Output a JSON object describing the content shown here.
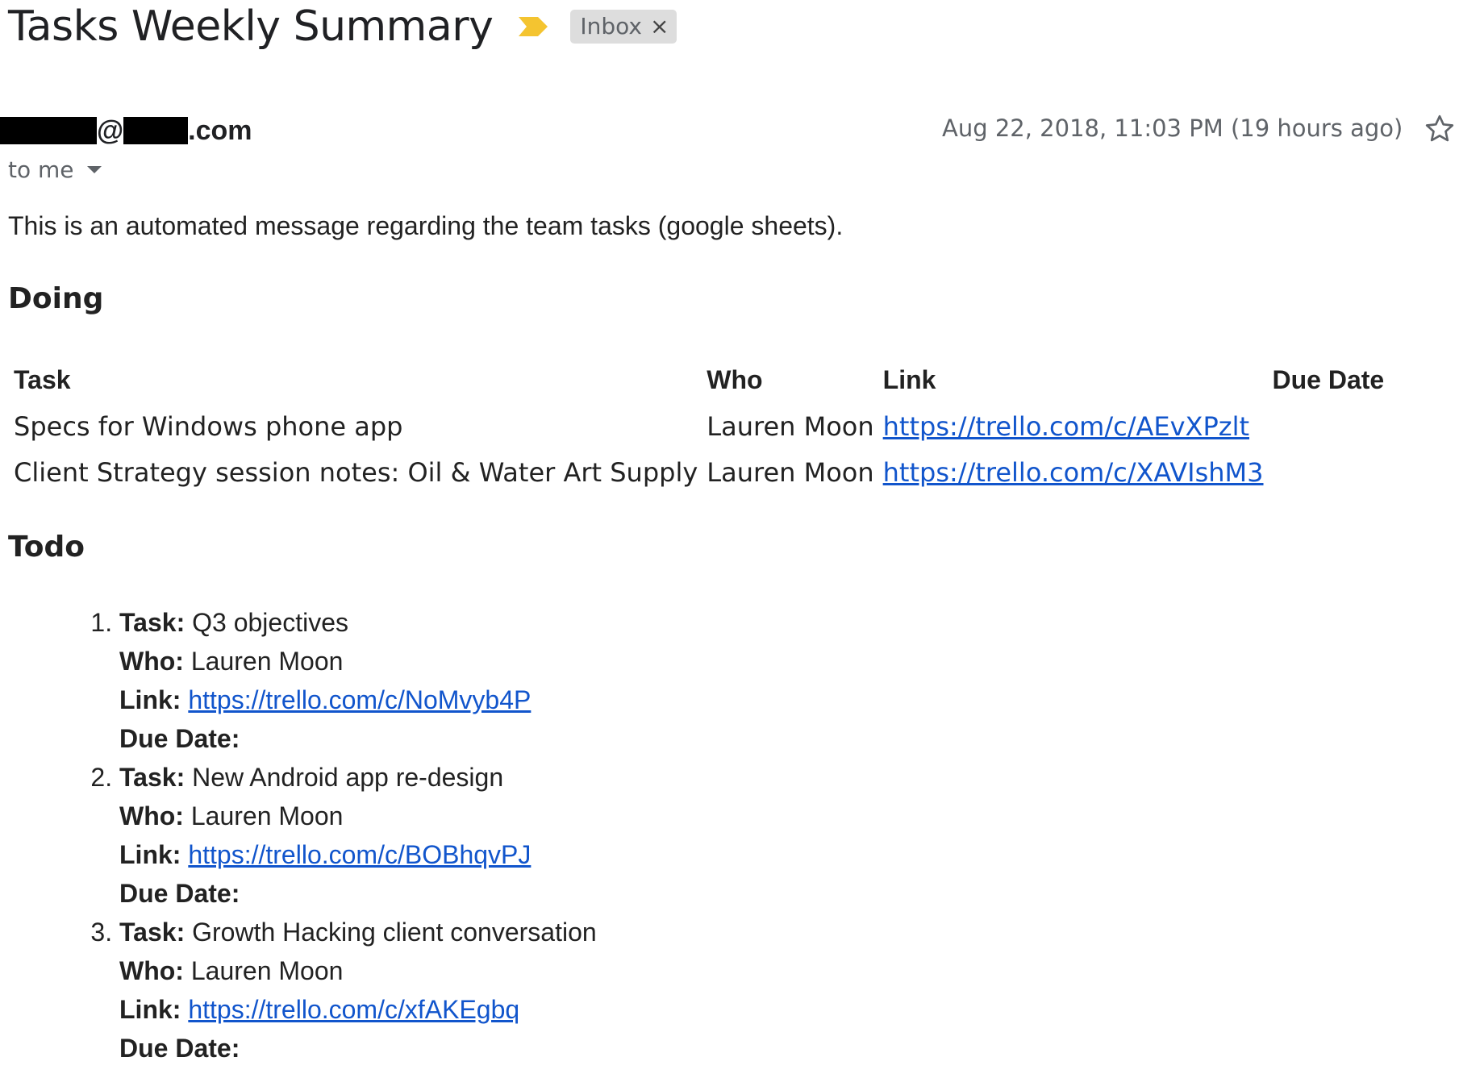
{
  "email": {
    "subject": "Tasks Weekly Summary",
    "label_chip": "Inbox",
    "label_chip_close": "×",
    "sender": {
      "at": "@",
      "domain_suffix": ".com"
    },
    "date": "Aug 22, 2018, 11:03 PM (19 hours ago)",
    "recipient": "to me",
    "intro": "This is an automated message regarding the team tasks (google sheets).",
    "colors": {
      "important_marker": "#f4c430",
      "link": "#1155cc",
      "chip_bg": "#dddddd"
    }
  },
  "doing": {
    "heading": "Doing",
    "columns": [
      "Task",
      "Who",
      "Link",
      "Due Date"
    ],
    "rows": [
      {
        "task": "Specs for Windows phone app",
        "who": "Lauren Moon",
        "link": "https://trello.com/c/AEvXPzlt",
        "due": ""
      },
      {
        "task": "Client Strategy session notes: Oil & Water Art Supply",
        "who": "Lauren Moon",
        "link": "https://trello.com/c/XAVIshM3",
        "due": ""
      }
    ]
  },
  "todo": {
    "heading": "Todo",
    "labels": {
      "task": "Task:",
      "who": "Who:",
      "link": "Link:",
      "due": "Due Date:"
    },
    "items": [
      {
        "task": "Q3 objectives",
        "who": "Lauren Moon",
        "link": "https://trello.com/c/NoMvyb4P",
        "due": ""
      },
      {
        "task": "New Android app re-design",
        "who": "Lauren Moon",
        "link": "https://trello.com/c/BOBhqvPJ",
        "due": ""
      },
      {
        "task": "Growth Hacking client conversation",
        "who": "Lauren Moon",
        "link": "https://trello.com/c/xfAKEgbq",
        "due": ""
      }
    ]
  }
}
